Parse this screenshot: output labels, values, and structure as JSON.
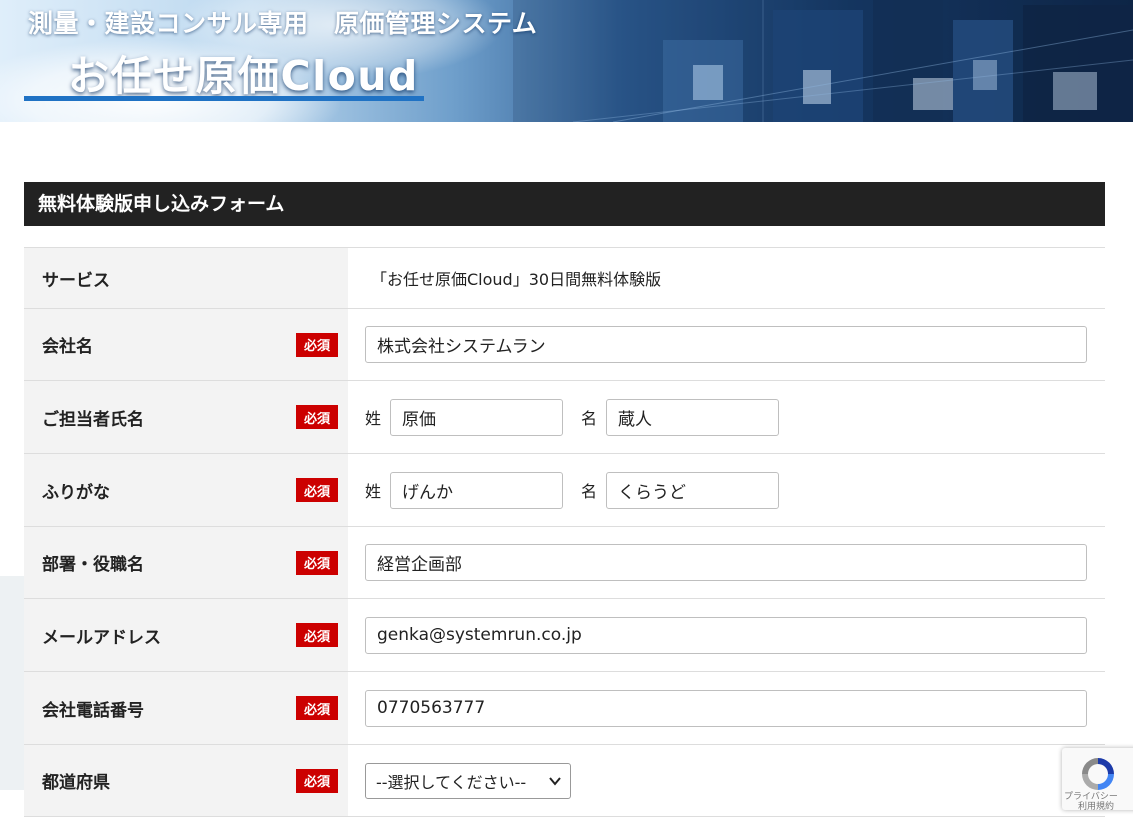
{
  "banner": {
    "subtitle": "測量・建設コンサル専用　原価管理システム",
    "title": "お任せ原価Cloud"
  },
  "form": {
    "header": "無料体験版申し込みフォーム",
    "required_label": "必須",
    "rows": {
      "service": {
        "label": "サービス",
        "value": "「お任せ原価Cloud」30日間無料体験版"
      },
      "company": {
        "label": "会社名",
        "value": "株式会社システムラン"
      },
      "contact_name": {
        "label": "ご担当者氏名",
        "last_label": "姓",
        "last_value": "原価",
        "first_label": "名",
        "first_value": "蔵人"
      },
      "furigana": {
        "label": "ふりがな",
        "last_label": "姓",
        "last_value": "げんか",
        "first_label": "名",
        "first_value": "くらうど"
      },
      "department": {
        "label": "部署・役職名",
        "value": "経営企画部"
      },
      "email": {
        "label": "メールアドレス",
        "value": "genka@systemrun.co.jp"
      },
      "phone": {
        "label": "会社電話番号",
        "value": "0770563777"
      },
      "prefecture": {
        "label": "都道府県",
        "selected": "--選択してください--"
      }
    }
  },
  "recaptcha": {
    "privacy": "プライバシー",
    "terms": "利用規約"
  },
  "colors": {
    "header_bg": "#222222",
    "required_bg": "#cc0000",
    "label_bg": "#f3f3f3",
    "banner_underline": "#1f72c4"
  }
}
